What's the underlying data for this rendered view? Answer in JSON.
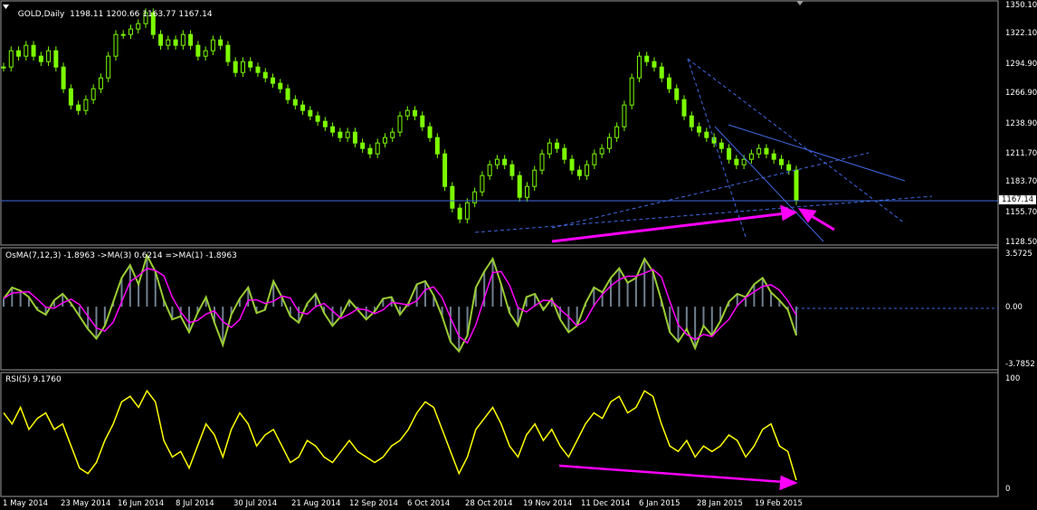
{
  "colors": {
    "background": "#000000",
    "panel_border": "#9c9c9c",
    "price_candles": "#7cfc00",
    "osma_histogram": "#708090",
    "osma_line1": "#9acd32",
    "osma_line2": "#ff00ff",
    "rsi_line": "#ffff00",
    "trendline": "#4169e1",
    "arrows": "#ff00ff",
    "axis_text": "#ffffff"
  },
  "icons": {
    "collapse": "triangle-down-icon"
  },
  "chart_data": [
    {
      "type": "candlestick",
      "title": "GOLD,Daily",
      "ohlc_header": "1198.11 1200.66 1163.77 1167.14",
      "current_price": "1167.14",
      "price_levels": [
        "1350.10",
        "1322.10",
        "1294.90",
        "1266.90",
        "1238.90",
        "1211.70",
        "1183.70",
        "1167.14",
        "1155.70",
        "1128.50"
      ],
      "ylim": [
        1128.5,
        1350.1
      ],
      "x_dates": [
        "1 May 2014",
        "23 May 2014",
        "16 Jun 2014",
        "8 Jul 2014",
        "30 Jul 2014",
        "21 Aug 2014",
        "12 Sep 2014",
        "6 Oct 2014",
        "28 Oct 2014",
        "19 Nov 2014",
        "11 Dec 2014",
        "6 Jan 2015",
        "28 Jan 2015",
        "19 Feb 2015"
      ],
      "close_series": [
        1290,
        1305,
        1300,
        1310,
        1300,
        1295,
        1305,
        1290,
        1270,
        1255,
        1250,
        1260,
        1270,
        1280,
        1300,
        1320,
        1320,
        1325,
        1330,
        1340,
        1320,
        1310,
        1315,
        1310,
        1320,
        1310,
        1300,
        1305,
        1315,
        1310,
        1295,
        1285,
        1295,
        1290,
        1285,
        1280,
        1275,
        1270,
        1260,
        1255,
        1250,
        1245,
        1240,
        1235,
        1230,
        1225,
        1230,
        1220,
        1215,
        1210,
        1220,
        1225,
        1230,
        1245,
        1250,
        1245,
        1235,
        1225,
        1210,
        1180,
        1160,
        1150,
        1165,
        1175,
        1190,
        1200,
        1205,
        1200,
        1190,
        1170,
        1180,
        1195,
        1210,
        1220,
        1215,
        1205,
        1195,
        1190,
        1200,
        1210,
        1215,
        1225,
        1235,
        1255,
        1280,
        1300,
        1295,
        1290,
        1280,
        1270,
        1260,
        1245,
        1235,
        1230,
        1225,
        1220,
        1215,
        1205,
        1200,
        1205,
        1210,
        1215,
        1210,
        1205,
        1200,
        1195,
        1167
      ]
    },
    {
      "type": "line",
      "title": "OsMA(7,12,3) -1.8963 ->MA(3) 0.6214 =>MA(1) -1.8963",
      "levels": [
        "3.5725",
        "0.00",
        "-3.7852"
      ],
      "ylim": [
        -3.7852,
        3.5725
      ],
      "values": [
        0.5,
        1.2,
        1.0,
        0.6,
        -0.2,
        -0.5,
        0.4,
        0.8,
        0.2,
        -0.6,
        -1.4,
        -2.0,
        -1.2,
        0.3,
        1.8,
        2.6,
        1.4,
        3.2,
        2.2,
        0.4,
        -0.8,
        -0.6,
        -1.6,
        -0.4,
        0.6,
        -1.0,
        -2.4,
        -0.5,
        0.5,
        1.2,
        -0.4,
        -0.2,
        1.6,
        0.6,
        -0.6,
        -1.0,
        0.2,
        0.8,
        -0.4,
        -1.2,
        -0.6,
        0.4,
        -0.2,
        -0.8,
        -0.3,
        0.5,
        0.6,
        -0.5,
        0.2,
        1.4,
        1.6,
        0.7,
        -0.6,
        -2.2,
        -2.8,
        -1.8,
        1.2,
        2.2,
        3.0,
        1.4,
        -0.4,
        -1.2,
        0.6,
        0.8,
        -0.2,
        0.5,
        -0.8,
        -1.6,
        -1.2,
        0.2,
        1.2,
        0.9,
        1.8,
        2.4,
        1.5,
        1.8,
        3.0,
        2.2,
        0.4,
        -1.6,
        -2.2,
        -1.4,
        -2.6,
        -1.2,
        -1.8,
        -0.9,
        0.3,
        0.8,
        0.6,
        1.4,
        1.8,
        0.9,
        0.4,
        -0.2,
        -1.8
      ]
    },
    {
      "type": "line",
      "title": "RSI(5) 9.1760",
      "levels": [
        "100",
        "0"
      ],
      "ylim": [
        0,
        100
      ],
      "values": [
        70,
        60,
        75,
        55,
        65,
        70,
        55,
        60,
        40,
        20,
        15,
        25,
        45,
        60,
        80,
        85,
        75,
        90,
        80,
        45,
        30,
        35,
        20,
        40,
        60,
        50,
        30,
        55,
        70,
        60,
        40,
        50,
        55,
        40,
        25,
        30,
        45,
        40,
        30,
        25,
        35,
        45,
        35,
        30,
        25,
        30,
        40,
        45,
        55,
        70,
        80,
        75,
        55,
        35,
        15,
        30,
        55,
        65,
        75,
        60,
        40,
        30,
        50,
        60,
        45,
        55,
        40,
        30,
        45,
        60,
        70,
        65,
        80,
        85,
        70,
        75,
        90,
        85,
        60,
        40,
        35,
        45,
        30,
        40,
        35,
        40,
        50,
        45,
        30,
        40,
        55,
        60,
        40,
        35,
        9
      ]
    }
  ]
}
